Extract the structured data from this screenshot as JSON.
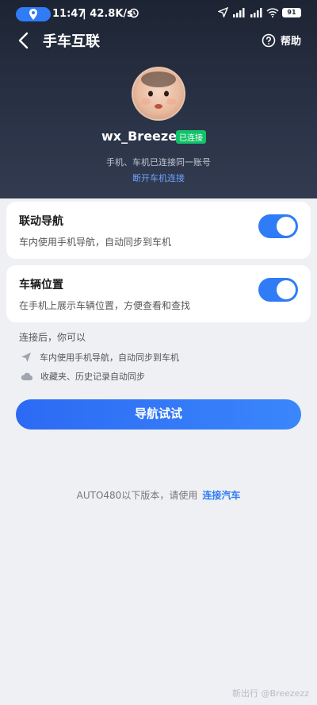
{
  "status_bar": {
    "time": "11:47",
    "speed": "| 42.8K/s",
    "battery": "91"
  },
  "header": {
    "title": "手车互联",
    "help_label": "帮助"
  },
  "profile": {
    "username": "wx_Breeze.",
    "status_badge": "已连接",
    "subtitle": "手机、车机已连接同一账号",
    "disconnect_link": "断开车机连接"
  },
  "settings": [
    {
      "title": "联动导航",
      "description": "车内使用手机导航，自动同步到车机",
      "enabled": true
    },
    {
      "title": "车辆位置",
      "description": "在手机上展示车辆位置，方便查看和查找",
      "enabled": true
    }
  ],
  "hints": {
    "title": "连接后，你可以",
    "items": [
      "车内使用手机导航，自动同步到车机",
      "收藏夹、历史记录自动同步"
    ]
  },
  "primary_button": "导航试试",
  "footer": {
    "note": "AUTO480以下版本，请使用",
    "link": "连接汽车"
  },
  "watermark": "新出行 @Breezezz",
  "colors": {
    "accent": "#2f7cf6",
    "connected_badge": "#12c26a",
    "header_bg": "#1d2433"
  }
}
